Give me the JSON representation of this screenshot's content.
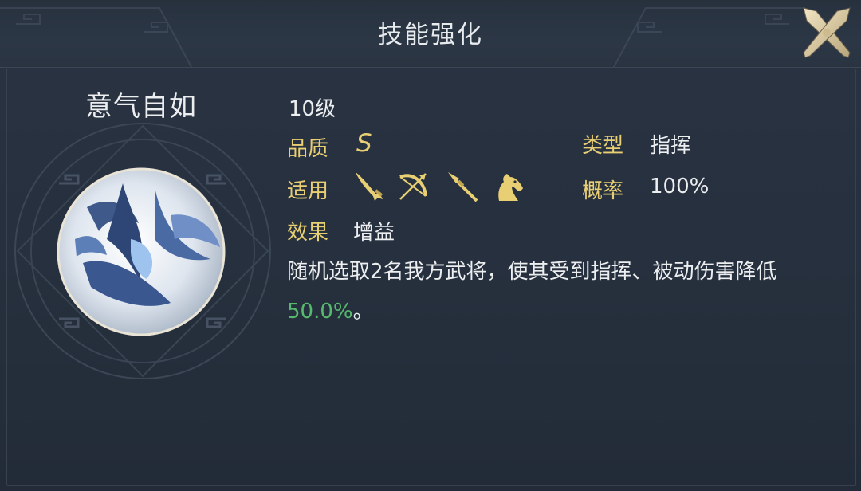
{
  "header": {
    "title": "技能强化"
  },
  "skill": {
    "name": "意气自如",
    "level": "10级",
    "quality_label": "品质",
    "quality_value": "S",
    "type_label": "类型",
    "type_value": "指挥",
    "applicable_label": "适用",
    "applicable_icons": [
      "sword-icon",
      "bow-icon",
      "spear-icon",
      "horse-icon"
    ],
    "chance_label": "概率",
    "chance_value": "100%",
    "effect_label": "效果",
    "effect_value": "增益",
    "description_prefix": "随机选取2名我方武将，使其受到指挥、被动伤害降低",
    "description_highlight": "50.0%",
    "description_suffix": "。"
  },
  "colors": {
    "accent_gold": "#e9cf73",
    "highlight_green": "#56b96d",
    "text": "#eceef0",
    "background": "#252f3c"
  }
}
